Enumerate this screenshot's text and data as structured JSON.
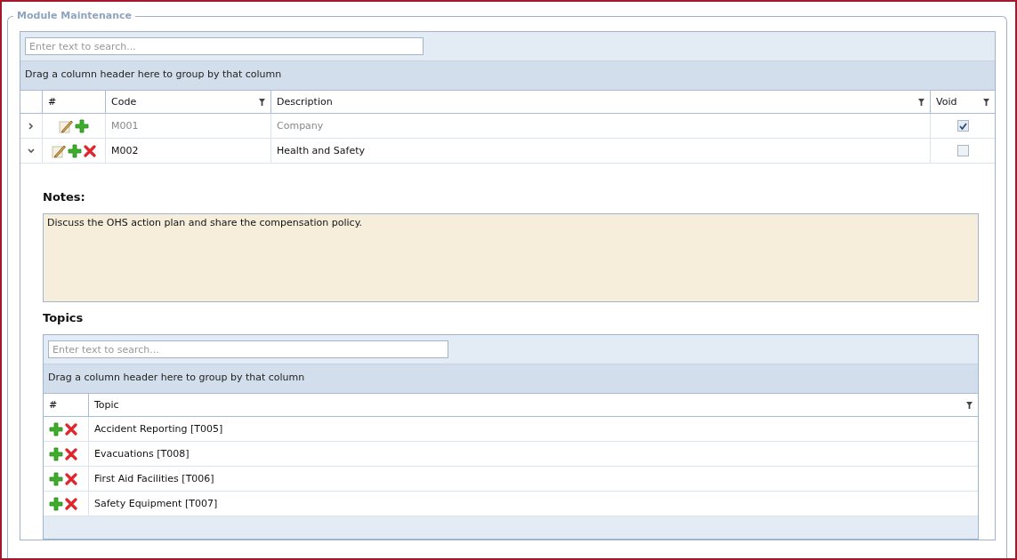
{
  "panel": {
    "title": "Module Maintenance"
  },
  "grid": {
    "search": {
      "placeholder": "Enter text to search..."
    },
    "group_hint": "Drag a column header here to group by that column",
    "columns": [
      {
        "label": "#",
        "filter": false
      },
      {
        "label": "Code",
        "filter": true
      },
      {
        "label": "Description",
        "filter": true
      },
      {
        "label": "Void",
        "filter": true
      }
    ],
    "rows": [
      {
        "expanded": false,
        "deletable": false,
        "code": "M001",
        "description": "Company",
        "void": true
      },
      {
        "expanded": true,
        "deletable": true,
        "code": "M002",
        "description": "Health and Safety",
        "void": false
      }
    ]
  },
  "detail": {
    "notes_label": "Notes:",
    "notes": "Discuss the OHS action plan and share the compensation policy.",
    "topics_label": "Topics",
    "topics": {
      "search": {
        "placeholder": "Enter text to search..."
      },
      "group_hint": "Drag a column header here to group by that column",
      "columns": [
        {
          "label": "#",
          "filter": false
        },
        {
          "label": "Topic",
          "filter": true
        }
      ],
      "rows": [
        {
          "topic": "Accident Reporting [T005]"
        },
        {
          "topic": "Evacuations [T008]"
        },
        {
          "topic": "First Aid Facilities [T006]"
        },
        {
          "topic": "Safety Equipment [T007]"
        }
      ]
    }
  }
}
